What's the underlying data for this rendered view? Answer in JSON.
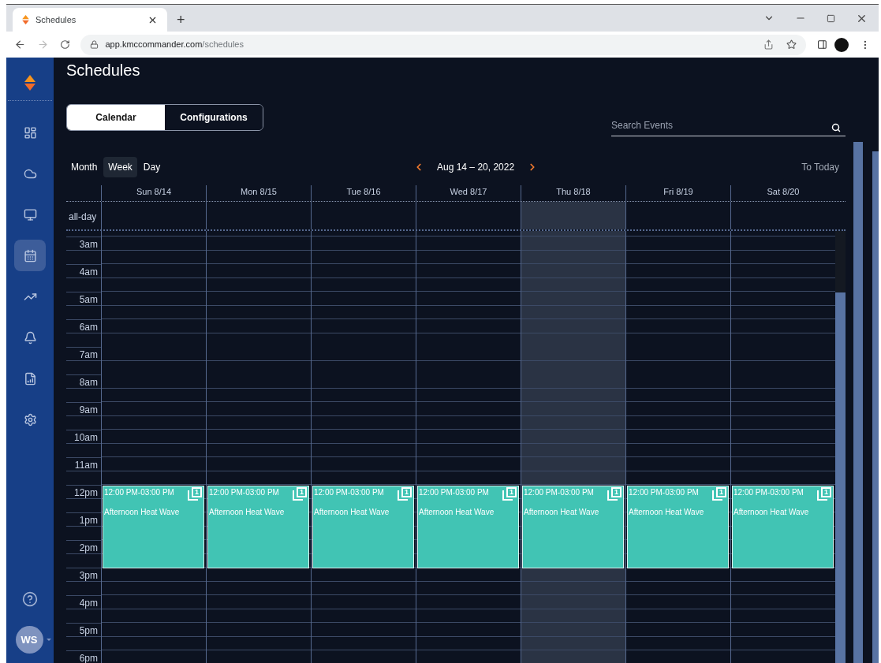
{
  "browser": {
    "tab_title": "Schedules",
    "new_tab": "+",
    "url_host": "app.kmccommander.com",
    "url_path": "/schedules"
  },
  "sidebar": {
    "items": [
      {
        "kind": "dashboard",
        "selected": false
      },
      {
        "kind": "cloud",
        "selected": false
      },
      {
        "kind": "network",
        "selected": false
      },
      {
        "kind": "calendar",
        "selected": true
      },
      {
        "kind": "trend",
        "selected": false
      },
      {
        "kind": "bell",
        "selected": false
      },
      {
        "kind": "report",
        "selected": false
      },
      {
        "kind": "settings",
        "selected": false
      }
    ],
    "avatar": "WS"
  },
  "page": {
    "title": "Schedules"
  },
  "tabs": [
    {
      "label": "Calendar",
      "selected": true
    },
    {
      "label": "Configurations",
      "selected": false
    }
  ],
  "search": {
    "placeholder": "Search Events"
  },
  "views": [
    {
      "label": "Month",
      "selected": false
    },
    {
      "label": "Week",
      "selected": true
    },
    {
      "label": "Day",
      "selected": false
    }
  ],
  "date_range": "Aug 14 – 20, 2022",
  "today_button": "To Today",
  "all_day_label": "all-day",
  "hours": [
    "3am",
    "4am",
    "5am",
    "6am",
    "7am",
    "8am",
    "9am",
    "10am",
    "11am",
    "12pm",
    "1pm",
    "2pm",
    "3pm",
    "4pm",
    "5pm",
    "6pm"
  ],
  "days": [
    {
      "label": "Sun 8/14",
      "today": false,
      "events": [
        {
          "time": "12:00 PM-03:00 PM",
          "title": "Afternoon Heat Wave",
          "count": "1"
        }
      ]
    },
    {
      "label": "Mon 8/15",
      "today": false,
      "events": [
        {
          "time": "12:00 PM-03:00 PM",
          "title": "Afternoon Heat Wave",
          "count": "1"
        }
      ]
    },
    {
      "label": "Tue 8/16",
      "today": false,
      "events": [
        {
          "time": "12:00 PM-03:00 PM",
          "title": "Afternoon Heat Wave",
          "count": "1"
        }
      ]
    },
    {
      "label": "Wed 8/17",
      "today": false,
      "events": [
        {
          "time": "12:00 PM-03:00 PM",
          "title": "Afternoon Heat Wave",
          "count": "1"
        }
      ]
    },
    {
      "label": "Thu 8/18",
      "today": true,
      "events": [
        {
          "time": "12:00 PM-03:00 PM",
          "title": "Afternoon Heat Wave",
          "count": "1"
        }
      ]
    },
    {
      "label": "Fri 8/19",
      "today": false,
      "events": [
        {
          "time": "12:00 PM-03:00 PM",
          "title": "Afternoon Heat Wave",
          "count": "1"
        }
      ]
    },
    {
      "label": "Sat 8/20",
      "today": false,
      "events": [
        {
          "time": "12:00 PM-03:00 PM",
          "title": "Afternoon Heat Wave",
          "count": "1"
        }
      ]
    }
  ]
}
